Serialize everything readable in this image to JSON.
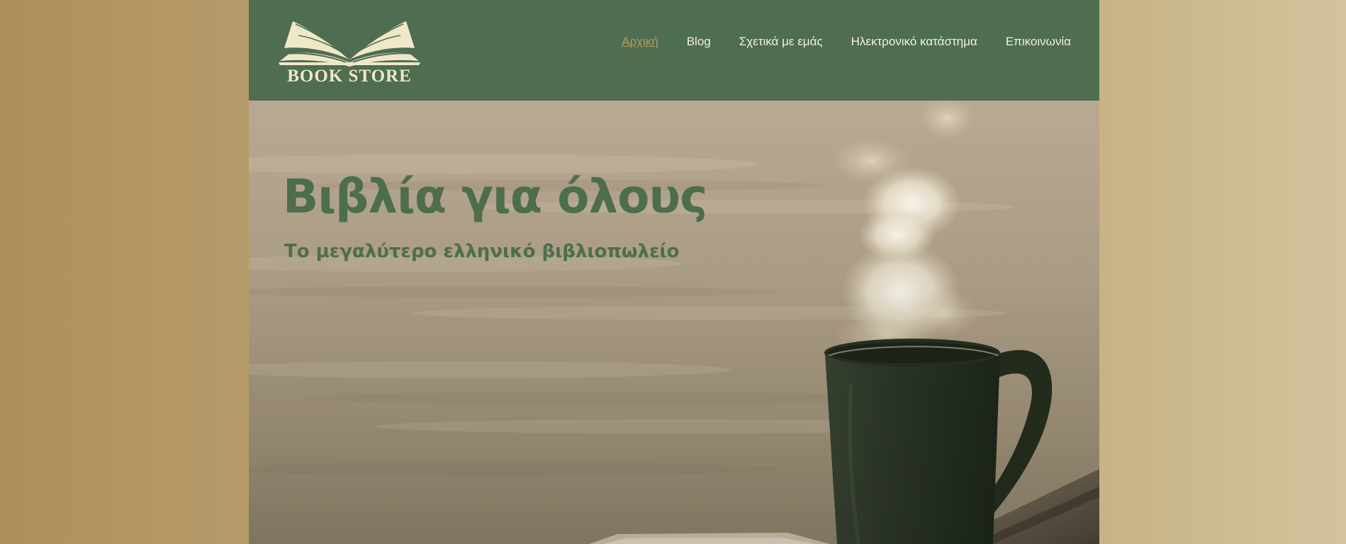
{
  "header": {
    "logo_text": "BOOK STORE",
    "nav": [
      {
        "label": "Αρχική",
        "active": true
      },
      {
        "label": "Blog",
        "active": false
      },
      {
        "label": "Σχετικά με εμάς",
        "active": false
      },
      {
        "label": "Ηλεκτρονικό κατάστημα",
        "active": false
      },
      {
        "label": "Επικοινωνία",
        "active": false
      }
    ]
  },
  "hero": {
    "title": "Βιβλία για όλους",
    "subtitle": "Το μεγαλύτερο ελληνικό βιβλιοπωλείο"
  },
  "colors": {
    "header_bg": "#4e6d51",
    "accent": "#b39b68",
    "heading": "#4c6e4c",
    "nav_text": "#f4f0e2"
  },
  "icons": {
    "logo": "open-book-icon",
    "hero_image": "coffee-mug-image"
  }
}
